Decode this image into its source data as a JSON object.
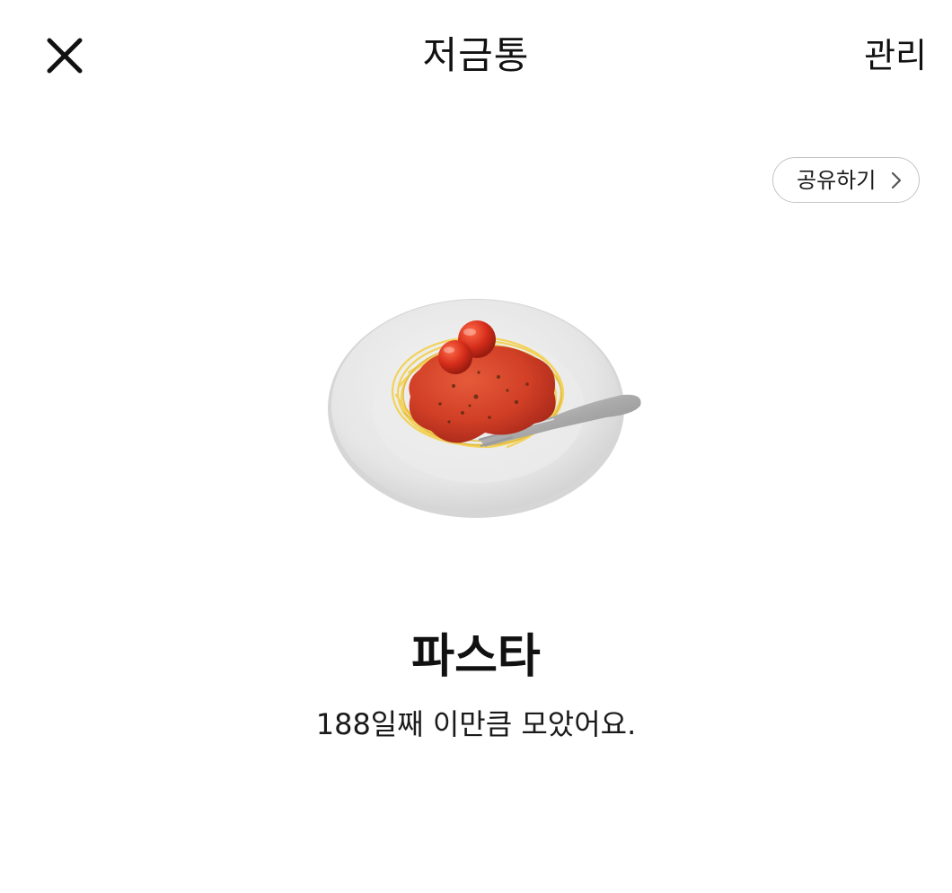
{
  "header": {
    "title": "저금통",
    "manage_label": "관리",
    "close_icon": "close-icon"
  },
  "share": {
    "label": "공유하기",
    "icon": "chevron-right-icon"
  },
  "piggy": {
    "image": "pasta-icon",
    "item_name": "파스타",
    "message": "188일째 이만큼 모았어요."
  },
  "colors": {
    "background": "#ffffff",
    "text": "#111111",
    "border": "#c4c4c4",
    "sauce": "#d8402a",
    "noodle": "#f2d25a",
    "plate": "#e8e8e8"
  }
}
